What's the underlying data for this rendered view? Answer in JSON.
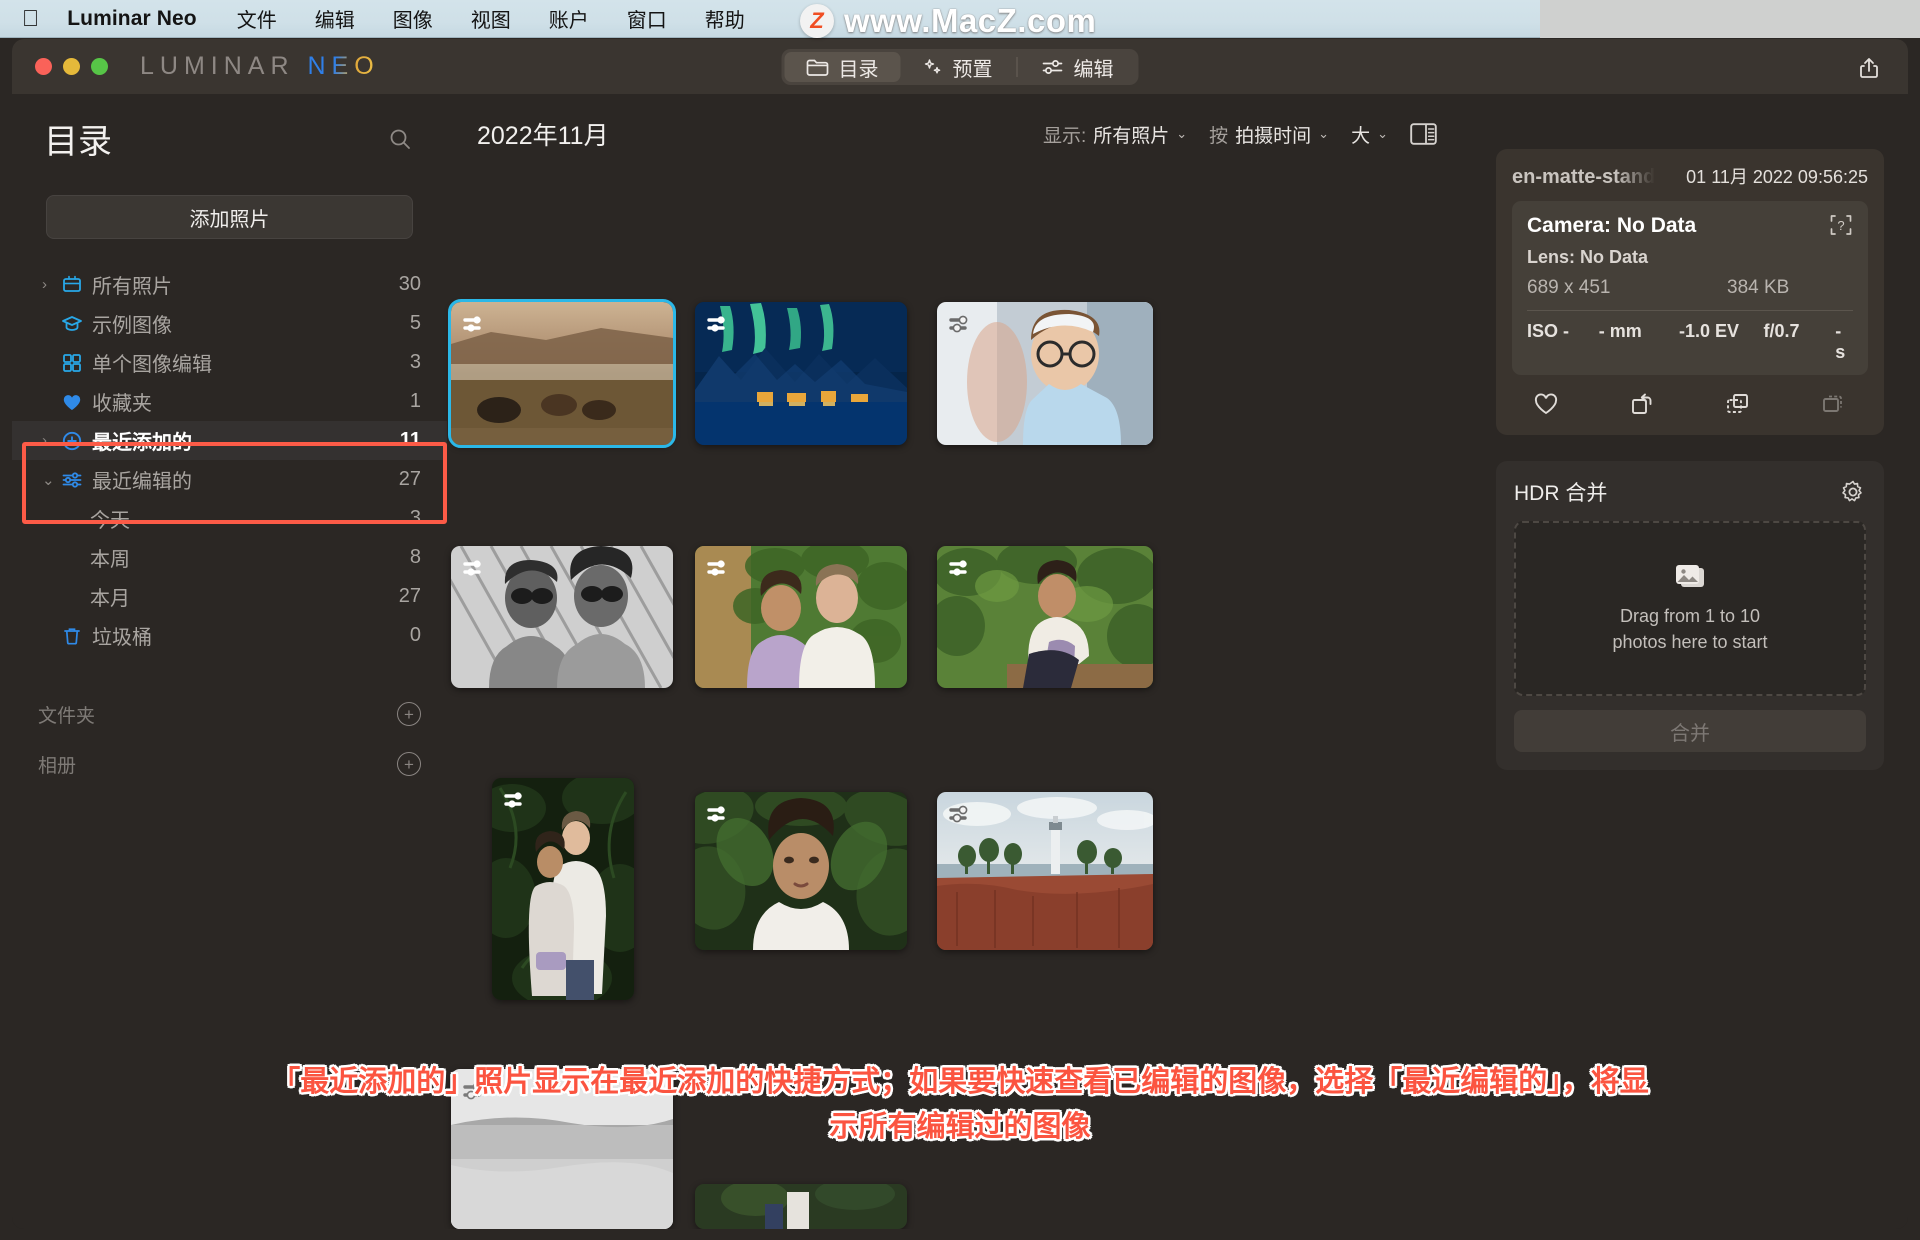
{
  "menubar": {
    "apple_icon": "apple-icon",
    "app_name": "Luminar Neo",
    "items": [
      "文件",
      "编辑",
      "图像",
      "视图",
      "账户",
      "窗口",
      "帮助"
    ]
  },
  "watermark": {
    "badge": "Z",
    "text": "www.MacZ.com"
  },
  "window": {
    "logo_primary": "LUMINAR",
    "logo_secondary": "NEO",
    "share_icon": "share-icon",
    "tabs": [
      {
        "label": "目录",
        "icon": "folder-icon",
        "active": true
      },
      {
        "label": "预置",
        "icon": "sparkle-icon",
        "active": false
      },
      {
        "label": "编辑",
        "icon": "sliders-icon",
        "active": false
      }
    ]
  },
  "sidebar": {
    "title": "目录",
    "search_icon": "search-icon",
    "add_photos_label": "添加照片",
    "items": [
      {
        "label": "所有照片",
        "count": "30",
        "icon": "library-icon",
        "chevron": "right",
        "indent": false,
        "selected": false
      },
      {
        "label": "示例图像",
        "count": "5",
        "icon": "graduation-icon",
        "chevron": "",
        "indent": false,
        "selected": false
      },
      {
        "label": "单个图像编辑",
        "count": "3",
        "icon": "grid-icon",
        "chevron": "",
        "indent": false,
        "selected": false
      },
      {
        "label": "收藏夹",
        "count": "1",
        "icon": "heart-icon",
        "chevron": "",
        "indent": false,
        "selected": false
      },
      {
        "label": "最近添加的",
        "count": "11",
        "icon": "plus-circle-icon",
        "chevron": "right",
        "indent": false,
        "selected": true
      },
      {
        "label": "最近编辑的",
        "count": "27",
        "icon": "sliders-icon",
        "chevron": "down",
        "indent": false,
        "selected": false
      },
      {
        "label": "今天",
        "count": "3",
        "icon": "",
        "chevron": "",
        "indent": true,
        "selected": false
      },
      {
        "label": "本周",
        "count": "8",
        "icon": "",
        "chevron": "",
        "indent": true,
        "selected": false
      },
      {
        "label": "本月",
        "count": "27",
        "icon": "",
        "chevron": "",
        "indent": true,
        "selected": false
      },
      {
        "label": "垃圾桶",
        "count": "0",
        "icon": "trash-icon",
        "chevron": "",
        "indent": false,
        "selected": false
      }
    ],
    "sections": [
      {
        "label": "文件夹",
        "add_icon": "plus-icon"
      },
      {
        "label": "相册",
        "add_icon": "plus-icon"
      }
    ],
    "highlight_color": "#fc5b47"
  },
  "main": {
    "month_label": "2022年11月",
    "filters": [
      {
        "label": "显示:",
        "value": "所有照片",
        "chevron": true
      },
      {
        "label": "按",
        "value": "拍摄时间",
        "chevron": true
      },
      {
        "label": "",
        "value": "大",
        "chevron": true
      }
    ],
    "view_toggle_icon": "split-view-icon",
    "photos": [
      {
        "name": "horses-field",
        "badge": "edited-light",
        "selected": true
      },
      {
        "name": "aurora-village",
        "badge": "edited-light",
        "selected": false
      },
      {
        "name": "woman-glasses",
        "badge": "edited-dark",
        "selected": false
      },
      {
        "name": "couple-bw",
        "badge": "edited-light",
        "selected": false
      },
      {
        "name": "couple-green",
        "badge": "edited-light",
        "selected": false
      },
      {
        "name": "woman-garden",
        "badge": "edited-light",
        "selected": false
      },
      {
        "name": "couple-jungle",
        "badge": "edited-light",
        "selected": false
      },
      {
        "name": "woman-leaves",
        "badge": "edited-light",
        "selected": false
      },
      {
        "name": "lighthouse",
        "badge": "edited-dark",
        "selected": false
      },
      {
        "name": "beach-bw",
        "badge": "edited-light",
        "selected": false
      },
      {
        "name": "couple-partial",
        "badge": "",
        "selected": false
      }
    ]
  },
  "inspector": {
    "filename": "en-matte-stand",
    "datetime": "01 11月 2022 09:56:25",
    "camera": "Camera: No Data",
    "lens": "Lens: No Data",
    "dimensions": "689 x 451",
    "filesize": "384 KB",
    "help_icon": "help-icon",
    "exif": [
      "ISO -",
      "- mm",
      "-1.0 EV",
      "f/0.7",
      "- s"
    ],
    "actions": [
      {
        "icon": "heart-icon",
        "name": "favorite"
      },
      {
        "icon": "rotate-icon",
        "name": "rotate"
      },
      {
        "icon": "duplicate-icon",
        "name": "duplicate"
      },
      {
        "icon": "stack-icon",
        "name": "stack"
      }
    ],
    "hdr": {
      "title": "HDR 合并",
      "settings_icon": "gear-icon",
      "dropzone_icon": "photos-icon",
      "dropzone_line1": "Drag from 1 to 10",
      "dropzone_line2": "photos here to start",
      "merge_label": "合并"
    }
  },
  "caption": {
    "line1": "「最近添加的」照片显示在最近添加的快捷方式；如果要快速查看已编辑的图像，选择「最近编辑的」，将显",
    "line2": "示所有编辑过的图像"
  }
}
